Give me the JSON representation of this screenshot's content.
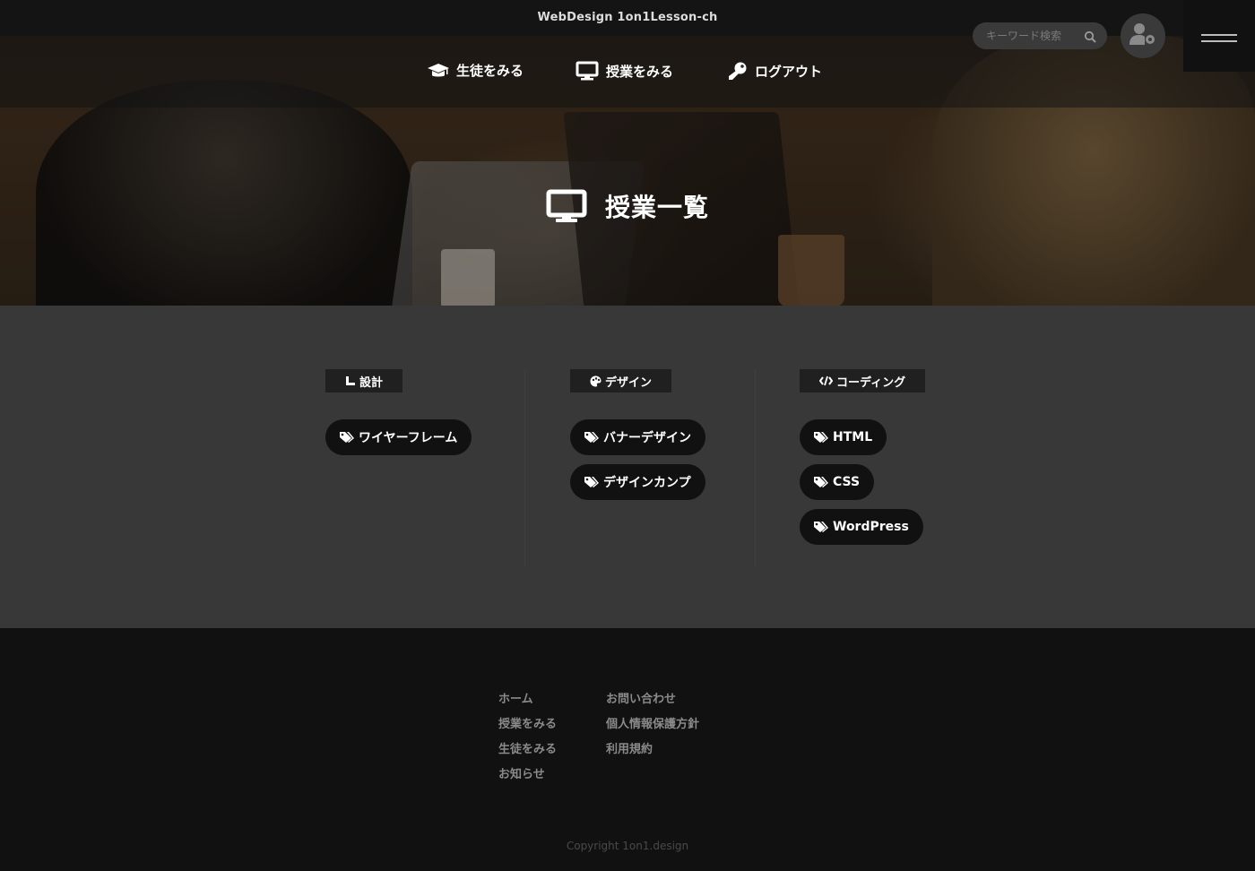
{
  "header": {
    "site_title": "WebDesign 1on1Lesson-ch",
    "search": {
      "placeholder": "キーワード検索",
      "icon": "search-icon"
    },
    "user_button_icon": "user-gear-icon",
    "menu_button_icon": "hamburger-icon"
  },
  "nav": {
    "items": [
      {
        "label": "生徒をみる",
        "icon": "graduation-cap-icon"
      },
      {
        "label": "授業をみる",
        "icon": "desktop-icon"
      },
      {
        "label": "ログアウト",
        "icon": "key-icon"
      }
    ]
  },
  "hero": {
    "title": "授業一覧",
    "icon": "desktop-icon"
  },
  "categories": [
    {
      "label": "設計",
      "icon": "ruler-icon",
      "tags": [
        "ワイヤーフレーム"
      ]
    },
    {
      "label": "デザイン",
      "icon": "palette-icon",
      "tags": [
        "バナーデザイン",
        "デザインカンプ"
      ]
    },
    {
      "label": "コーディング",
      "icon": "code-icon",
      "tags": [
        "HTML",
        "CSS",
        "WordPress"
      ]
    }
  ],
  "footer": {
    "col1": [
      "ホーム",
      "授業をみる",
      "生徒をみる",
      "お知らせ"
    ],
    "col2": [
      "お問い合わせ",
      "個人情報保護方針",
      "利用規約"
    ],
    "copyright": "Copyright 1on1.design"
  },
  "colors": {
    "header_bg": "#141414",
    "main_bg": "#383838",
    "footer_bg": "#111111",
    "tag_bg": "#111111",
    "category_label_bg": "#202020"
  }
}
